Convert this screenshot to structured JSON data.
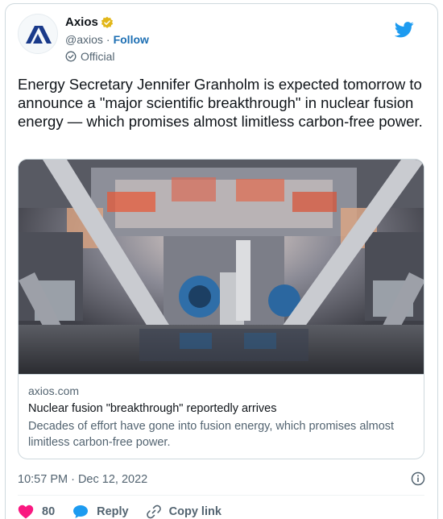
{
  "account": {
    "name": "Axios",
    "handle": "@axios",
    "separator": "·",
    "follow_label": "Follow",
    "label": "Official"
  },
  "tweet": {
    "text": "Energy Secretary Jennifer Granholm is expected tomorrow to announce a \"major scientific breakthrough\" in nuclear fusion energy — which promises almost limitless carbon-free power."
  },
  "link_card": {
    "domain": "axios.com",
    "title": "Nuclear fusion \"breakthrough\" reportedly arrives",
    "description": "Decades of effort have gone into fusion energy, which promises almost limitless carbon-free power."
  },
  "meta": {
    "timestamp": "10:57 PM · Dec 12, 2022"
  },
  "actions": {
    "like_count": "80",
    "reply_label": "Reply",
    "copy_link_label": "Copy link"
  },
  "colors": {
    "brand_blue": "#1d9bf0",
    "like_red": "#f91880",
    "verified_gold": "#e2b719",
    "axios_logo": "#1a3a8a"
  },
  "icons": {
    "avatar": "axios-logo",
    "verified": "verified-badge-icon",
    "official": "official-check-icon",
    "platform": "twitter-bird-icon",
    "info": "info-icon",
    "like": "heart-icon",
    "reply": "speech-bubble-icon",
    "copy_link": "link-icon"
  }
}
